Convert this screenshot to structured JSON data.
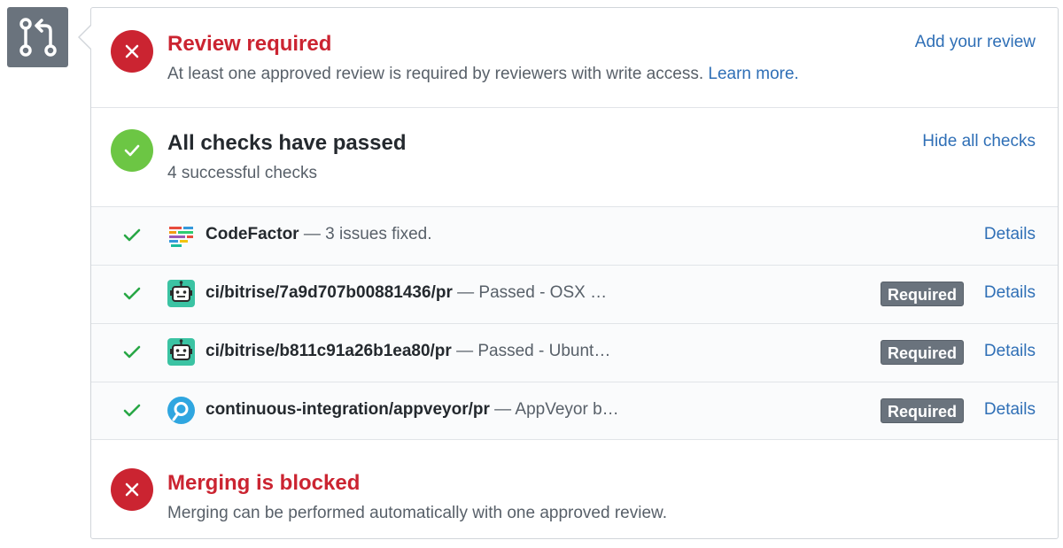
{
  "review": {
    "title": "Review required",
    "description": "At least one approved review is required by reviewers with write access.",
    "learn_more": "Learn more.",
    "action": "Add your review",
    "status_color": "#cb2431"
  },
  "checks": {
    "title": "All checks have passed",
    "subtitle": "4 successful checks",
    "action": "Hide all checks",
    "status_color": "#6cc644",
    "items": [
      {
        "name": "CodeFactor",
        "description": " — 3 issues fixed.",
        "required": "",
        "details": "Details",
        "icon": "codefactor-logo-icon"
      },
      {
        "name": "ci/bitrise/7a9d707b00881436/pr",
        "description": " — Passed - OSX …",
        "required": "Required",
        "details": "Details",
        "icon": "bitrise-robot-icon"
      },
      {
        "name": "ci/bitrise/b811c91a26b1ea80/pr",
        "description": " — Passed - Ubunt…",
        "required": "Required",
        "details": "Details",
        "icon": "bitrise-robot-icon"
      },
      {
        "name": "continuous-integration/appveyor/pr",
        "description": " — AppVeyor b…",
        "required": "Required",
        "details": "Details",
        "icon": "appveyor-logo-icon"
      }
    ]
  },
  "merge": {
    "title": "Merging is blocked",
    "description": "Merging can be performed automatically with one approved review.",
    "status_color": "#cb2431"
  }
}
